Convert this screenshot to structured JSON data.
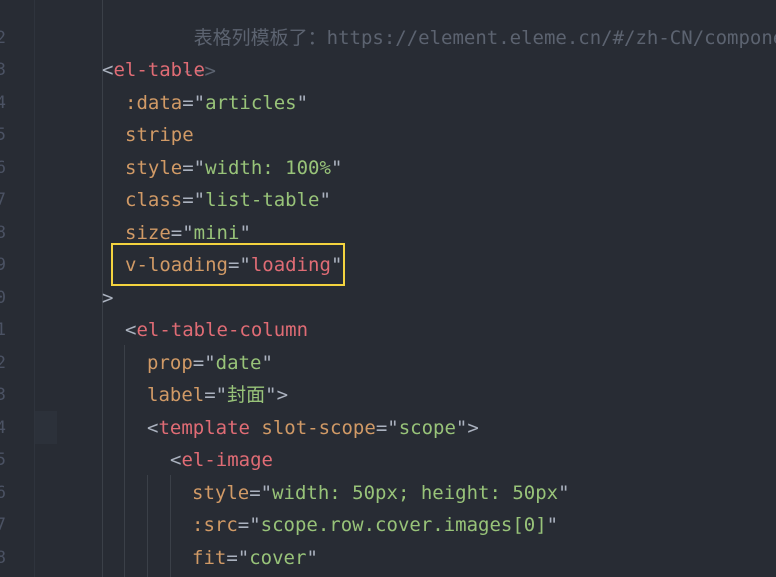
{
  "gutter": {
    "line_numbers": [
      "2",
      "3",
      "4",
      "5",
      "6",
      "7",
      "8",
      "9",
      "0",
      "1",
      "2",
      "3",
      "4",
      "5",
      "6",
      "7",
      "8"
    ]
  },
  "code": {
    "line0_comment": "表格列模板了：https://element.eleme.cn/#/zh-CN/component/t",
    "line1_comment_end": "-->",
    "line2": {
      "open": "<",
      "tag": "el-table"
    },
    "line3": {
      "attr": ":data",
      "eq": "=",
      "q1": "\"",
      "val": "articles",
      "q2": "\""
    },
    "line4": {
      "attr": "stripe"
    },
    "line5": {
      "attr": "style",
      "eq": "=",
      "q1": "\"",
      "val": "width: 100%",
      "q2": "\""
    },
    "line6": {
      "attr": "class",
      "eq": "=",
      "q1": "\"",
      "val": "list-table",
      "q2": "\""
    },
    "line7": {
      "attr": "size",
      "eq": "=",
      "q1": "\"",
      "val": "mini",
      "q2": "\""
    },
    "line8": {
      "attr": "v-loading",
      "eq": "=",
      "q1": "\"",
      "val": "loading",
      "q2": "\""
    },
    "line9": {
      "close": ">"
    },
    "line10": {
      "open": "<",
      "tag": "el-table-column"
    },
    "line11": {
      "attr": "prop",
      "eq": "=",
      "q1": "\"",
      "val": "date",
      "q2": "\""
    },
    "line12": {
      "attr": "label",
      "eq": "=",
      "q1": "\"",
      "val": "封面",
      "q2": "\"",
      "close": ">"
    },
    "line13": {
      "open": "<",
      "tag": "template",
      "attr": "slot-scope",
      "eq": "=",
      "q1": "\"",
      "val": "scope",
      "q2": "\"",
      "close": ">"
    },
    "line14": {
      "open": "<",
      "tag": "el-image"
    },
    "line15": {
      "attr": "style",
      "eq": "=",
      "q1": "\"",
      "val": "width: 50px; height: 50px",
      "q2": "\""
    },
    "line16": {
      "attr": ":src",
      "eq": "=",
      "q1": "\"",
      "val": "scope.row.cover.images[0]",
      "q2": "\""
    },
    "line17": {
      "attr": "fit",
      "eq": "=",
      "q1": "\"",
      "val": "cover",
      "q2": "\""
    }
  },
  "colors": {
    "background": "#282c34",
    "tag": "#e06c75",
    "attribute": "#d19a66",
    "string": "#98c379",
    "comment": "#5c6370",
    "highlight_box": "#f4d33f"
  }
}
